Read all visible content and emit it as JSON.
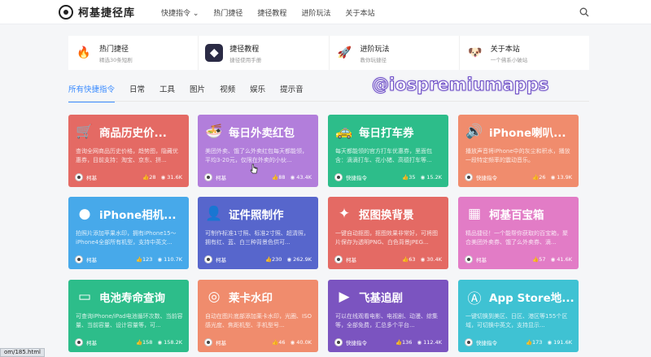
{
  "header": {
    "logo_text": "柯基捷径库",
    "nav": [
      "快捷指令 ⌄",
      "热门捷径",
      "捷径教程",
      "进阶玩法",
      "关于本站"
    ]
  },
  "featured": [
    {
      "title": "热门捷径",
      "sub": "精选30条短剧",
      "icon": "fire-icon",
      "bg": "#fff",
      "glyph": "🔥"
    },
    {
      "title": "捷径教程",
      "sub": "捷径使用手册",
      "icon": "shortcuts-app-icon",
      "bg": "#2b2b45",
      "glyph": "◆"
    },
    {
      "title": "进阶玩法",
      "sub": "教你玩捷径",
      "icon": "rocket-icon",
      "bg": "#fff",
      "glyph": "🚀"
    },
    {
      "title": "关于本站",
      "sub": "一个佛系小破站",
      "icon": "corgi-icon",
      "bg": "#fff",
      "glyph": "🐶"
    }
  ],
  "tabs": [
    "所有快捷指令",
    "日常",
    "工具",
    "图片",
    "视频",
    "娱乐",
    "提示音"
  ],
  "watermark": "@iospremiumapps",
  "cards": [
    {
      "title": "商品历史价...",
      "desc": "查询全网商品历史价格，趋势图，隐藏优惠券，目前支持：淘宝、京东、拼...",
      "author": "柯基",
      "likes": "28",
      "views": "31.6K",
      "color": "#e46a64",
      "icon": "cart-icon",
      "glyph": "🛒"
    },
    {
      "title": "每日外卖红包",
      "desc": "美团外卖、饿了么外卖红包每天都能领，平均3-20元，仅限在外卖的小伙...",
      "author": "柯基",
      "likes": "88",
      "views": "43.4K",
      "color": "#b27edb",
      "icon": "bowl-icon",
      "glyph": "🍜"
    },
    {
      "title": "每日打车券",
      "desc": "每天都能领的官方打车优惠券，里面包含：滴滴打车、花小猪、高德打车等...",
      "author": "快捷指令",
      "likes": "35",
      "views": "15.2K",
      "color": "#2dbd8a",
      "icon": "taxi-icon",
      "glyph": "🚕"
    },
    {
      "title": "iPhone喇叭...",
      "desc": "播放声音将iPhone中的灰尘和积水，播放一段特定频率的震动音乐。",
      "author": "快捷指令",
      "likes": "26",
      "views": "13.9K",
      "color": "#f08c6d",
      "icon": "speaker-icon",
      "glyph": "🔊"
    },
    {
      "title": "iPhone相机...",
      "desc": "拍照片添加苹果水印，拥有iPhone15～iPhone4全部所有机型，支持中英文...",
      "author": "柯基",
      "likes": "123",
      "views": "110.7K",
      "color": "#47a9ea",
      "icon": "apple-icon",
      "glyph": "●"
    },
    {
      "title": "证件照制作",
      "desc": "可制作标准1寸照、标准2寸照、超清照，拥有红、蓝、白三种背景色供可...",
      "author": "柯基",
      "likes": "230",
      "views": "262.9K",
      "color": "#5766cc",
      "icon": "person-icon",
      "glyph": "👤"
    },
    {
      "title": "抠图换背景",
      "desc": "一键自动抠图，抠图效果非常好，可将图片保存为透明PNG、白色背景JPEG...",
      "author": "柯基",
      "likes": "63",
      "views": "30.4K",
      "color": "#e46a64",
      "icon": "magic-wand-icon",
      "glyph": "✦"
    },
    {
      "title": "柯基百宝箱",
      "desc": "精品捷径！一个能帮你获取的百宝箱，聚合美团外卖券、饿了么外卖券、滴...",
      "author": "柯基",
      "likes": "57",
      "views": "41.6K",
      "color": "#e27cc6",
      "icon": "toolbox-icon",
      "glyph": "▦"
    },
    {
      "title": "电池寿命查询",
      "desc": "可查询iPhone/iPad电池循环次数、当前容量、当前容量、设计容量等，可...",
      "author": "柯基",
      "likes": "158",
      "views": "158.2K",
      "color": "#2dbd8a",
      "icon": "battery-icon",
      "glyph": "▭"
    },
    {
      "title": "莱卡水印",
      "desc": "自动在图片底部添加莱卡水印，光圈、ISO感光度、焦距机型、手机型号...",
      "author": "柯基",
      "likes": "46",
      "views": "40.0K",
      "color": "#f08c6d",
      "icon": "camera-icon",
      "glyph": "◎"
    },
    {
      "title": "飞基追剧",
      "desc": "可以在线观看电影、电视剧、动漫、综集等，全部免费，汇总多个平台...",
      "author": "快捷指令",
      "likes": "136",
      "views": "112.4K",
      "color": "#7b54c0",
      "icon": "clapper-icon",
      "glyph": "▶"
    },
    {
      "title": "App Store地...",
      "desc": "一键切换到美区、日区、港区等155个区域，可切换中英文，支持显示...",
      "author": "快捷指令",
      "likes": "173",
      "views": "191.6K",
      "color": "#3fc2d3",
      "icon": "app-store-icon",
      "glyph": "Ⓐ"
    }
  ],
  "statusbar": {
    "url": "om/185.html"
  }
}
